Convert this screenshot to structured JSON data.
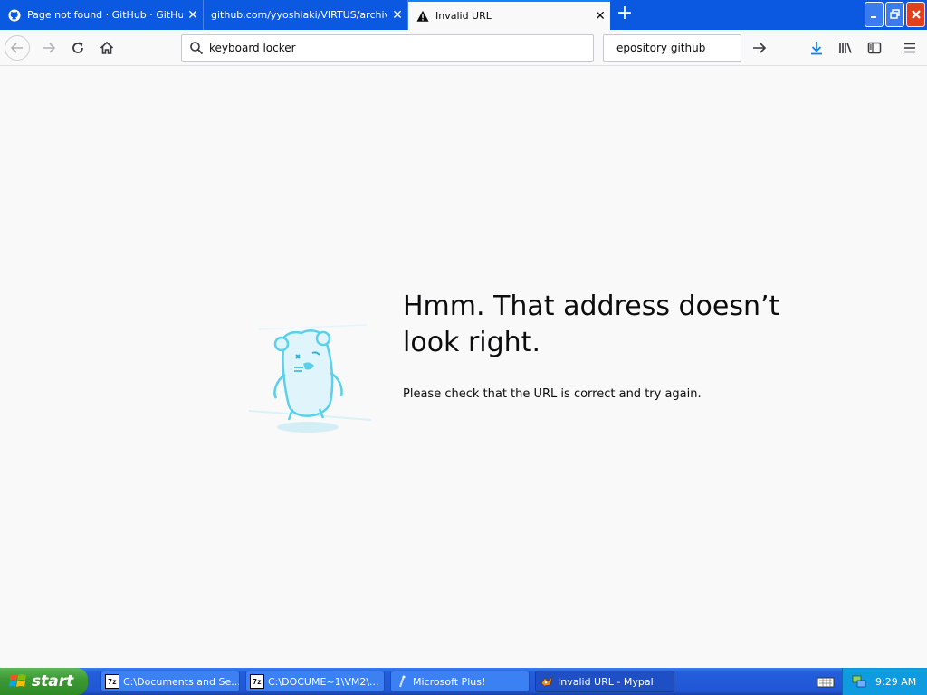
{
  "browser": {
    "tabs": [
      {
        "title": "Page not found · GitHub · GitHub",
        "icon": "github-icon"
      },
      {
        "title": "github.com/yyoshiaki/VIRTUS/archive/",
        "icon": "none"
      },
      {
        "title": "Invalid URL",
        "icon": "warning-icon",
        "active": true
      }
    ],
    "new_tab_label": "+",
    "url_value": "keyboard locker",
    "search_value": "epository github",
    "accent_color": "#0a59e0"
  },
  "page": {
    "title": "Hmm. That address doesn’t look right.",
    "description": "Please check that the URL is correct and try again."
  },
  "taskbar": {
    "start_label": "start",
    "items": [
      {
        "label": "C:\\Documents and Se...",
        "icon": "7z-icon"
      },
      {
        "label": "C:\\DOCUME~1\\VM2\\...",
        "icon": "7z-icon"
      },
      {
        "label": "Microsoft Plus!",
        "icon": "plus-icon"
      },
      {
        "label": "Invalid URL - Mypal",
        "icon": "mypal-icon",
        "active": true
      }
    ],
    "sevenz_badge": "7z",
    "clock": "9:29 AM"
  }
}
